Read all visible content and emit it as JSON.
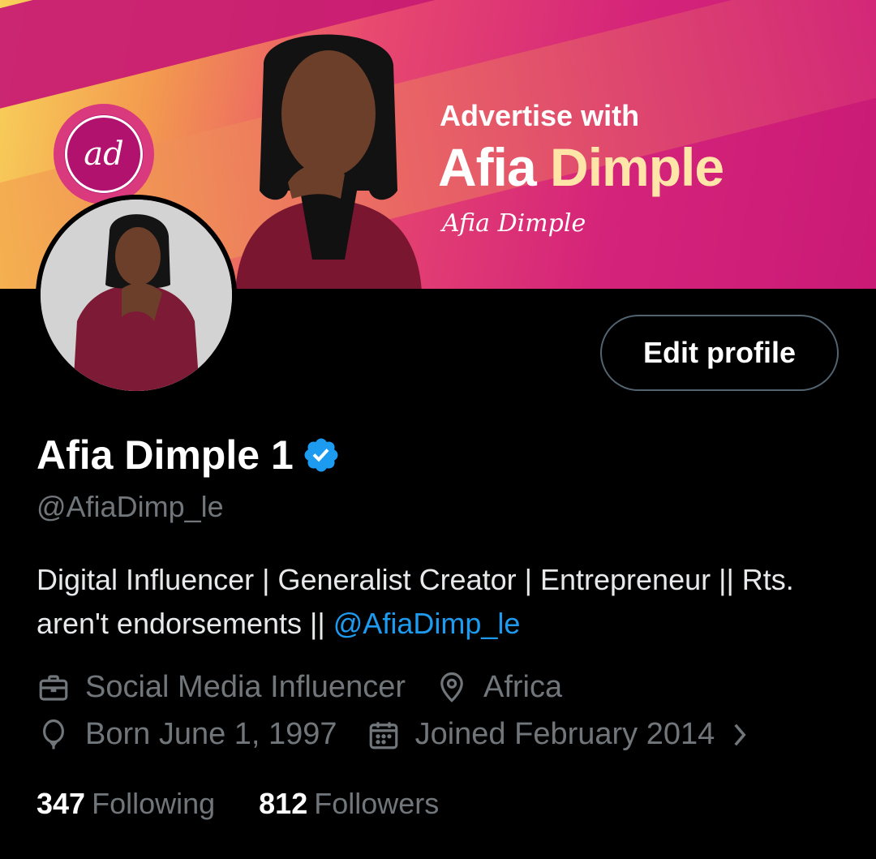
{
  "banner": {
    "logo_text": "ad",
    "line1": "Advertise with",
    "line2_first": "Afia",
    "line2_second": "Dimple",
    "signature": "Afia Dimple"
  },
  "profile": {
    "display_name": "Afia Dimple 1",
    "verified": true,
    "handle": "@AfiaDimp_le",
    "bio_text": "Digital Influencer | Generalist Creator | Entrepreneur || Rts. aren't endorsements || ",
    "bio_link": "@AfiaDimp_le",
    "category": "Social Media Influencer",
    "location": "Africa",
    "birthday": "Born June 1, 1997",
    "joined": "Joined February 2014",
    "following_count": "347",
    "following_label": "Following",
    "followers_count": "812",
    "followers_label": "Followers"
  },
  "actions": {
    "edit_profile": "Edit profile"
  },
  "colors": {
    "background": "#000000",
    "accent_link": "#1d9bf0",
    "secondary_text": "#71767b",
    "verified_badge": "#1d9bf0"
  }
}
